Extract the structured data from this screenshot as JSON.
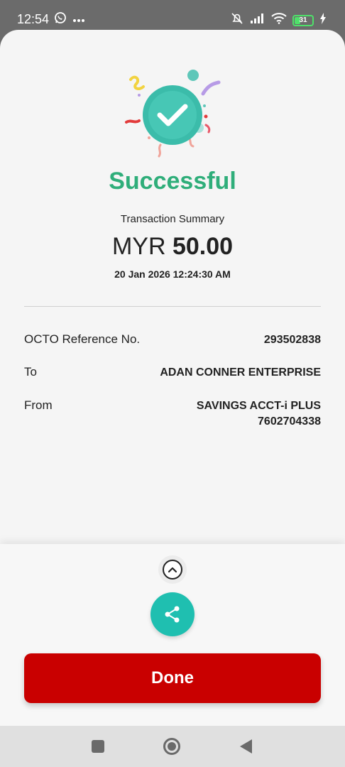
{
  "status_bar": {
    "time": "12:54",
    "battery": "31",
    "battery_percent": 31
  },
  "result": {
    "title": "Successful",
    "summary_label": "Transaction Summary",
    "currency": "MYR",
    "amount": "50.00",
    "datetime": "20 Jan 2026 12:24:30 AM"
  },
  "details": [
    {
      "label": "OCTO Reference No.",
      "value": "293502838"
    },
    {
      "label": "To",
      "value": "ADAN CONNER ENTERPRISE"
    },
    {
      "label": "From",
      "value": "SAVINGS ACCT-i PLUS",
      "value2": "7602704338"
    }
  ],
  "actions": {
    "done_label": "Done"
  },
  "colors": {
    "success": "#2fae7a",
    "primary_button": "#c90000",
    "share_button": "#1fbfb0"
  },
  "icons": [
    "whatsapp-icon",
    "more-icon",
    "mute-icon",
    "signal-icon",
    "wifi-icon",
    "battery-icon",
    "charging-icon",
    "check-icon",
    "chevron-up-icon",
    "share-icon"
  ]
}
